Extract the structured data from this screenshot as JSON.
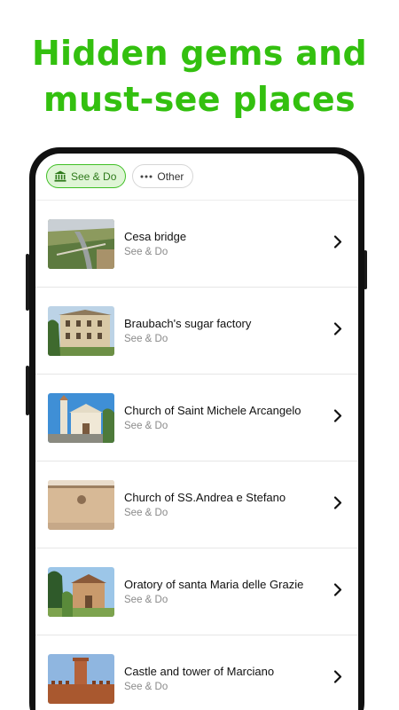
{
  "headline": {
    "line1": "Hidden gems and",
    "line2": "must-see places"
  },
  "filters": [
    {
      "label": "See & Do",
      "icon": "museum-icon",
      "active": true
    },
    {
      "label": "Other",
      "icon": "more-dots-icon",
      "active": false
    }
  ],
  "places": [
    {
      "title": "Cesa bridge",
      "category": "See & Do"
    },
    {
      "title": "Braubach's sugar factory",
      "category": "See & Do"
    },
    {
      "title": "Church of Saint Michele Arcangelo",
      "category": "See & Do"
    },
    {
      "title": "Church of SS.Andrea e Stefano",
      "category": "See & Do"
    },
    {
      "title": "Oratory of santa Maria delle Grazie",
      "category": "See & Do"
    },
    {
      "title": "Castle and tower of Marciano",
      "category": "See & Do"
    }
  ],
  "colors": {
    "accent": "#33c00f",
    "chip_active_bg": "#dff5d6",
    "chip_active_border": "#3fbf24"
  }
}
